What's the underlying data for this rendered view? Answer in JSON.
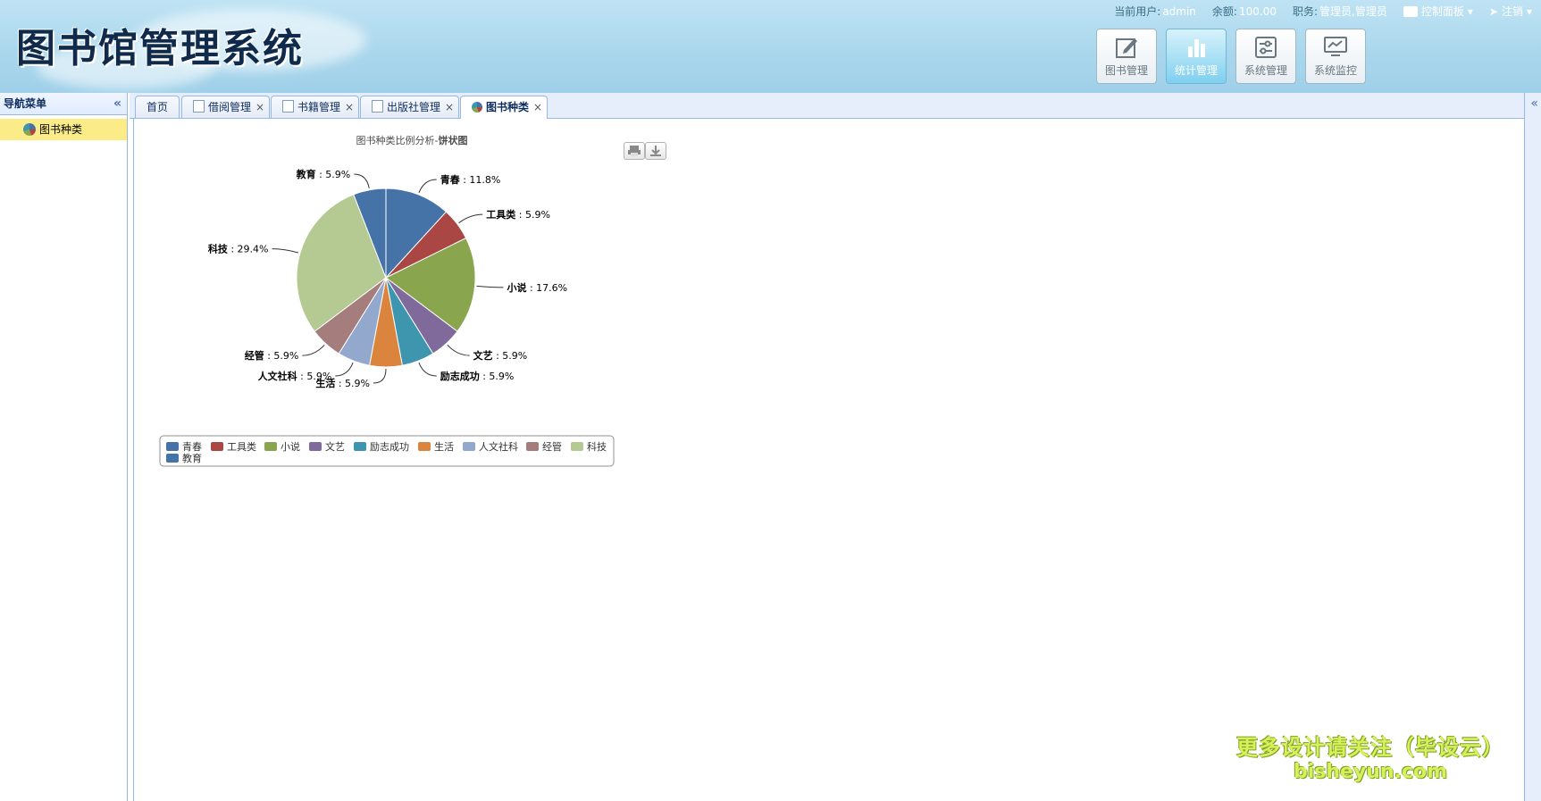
{
  "header": {
    "title": "图书馆管理系统",
    "current_user_label": "当前用户:",
    "current_user": "admin",
    "balance_label": "余额:",
    "balance": "100.00",
    "role_label": "职务:",
    "role": "管理员,管理员",
    "control_panel": "控制面板",
    "logout": "注销",
    "modules": [
      {
        "label": "图书管理",
        "icon": "edit-icon",
        "active": false
      },
      {
        "label": "统计管理",
        "icon": "bar-chart-icon",
        "active": true
      },
      {
        "label": "系统管理",
        "icon": "settings-sliders-icon",
        "active": false
      },
      {
        "label": "系统监控",
        "icon": "monitor-icon",
        "active": false
      }
    ]
  },
  "sidebar": {
    "title": "导航菜单",
    "items": [
      {
        "label": "图书种类",
        "selected": true
      }
    ]
  },
  "tabs": [
    {
      "label": "首页",
      "closable": false,
      "active": false
    },
    {
      "label": "借阅管理",
      "closable": true,
      "active": false
    },
    {
      "label": "书籍管理",
      "closable": true,
      "active": false
    },
    {
      "label": "出版社管理",
      "closable": true,
      "active": false
    },
    {
      "label": "图书种类",
      "closable": true,
      "active": true
    }
  ],
  "chart_data": {
    "type": "pie",
    "title": "图书种类比例分析- 饼状图",
    "title_main": "图书种类比例分析-",
    "title_bold": "饼状图",
    "slices": [
      {
        "name": "青春",
        "value": 11.8,
        "color": "#4572A7"
      },
      {
        "name": "工具类",
        "value": 5.9,
        "color": "#AA4643"
      },
      {
        "name": "小说",
        "value": 17.6,
        "color": "#89A54E"
      },
      {
        "name": "文艺",
        "value": 5.9,
        "color": "#80699B"
      },
      {
        "name": "励志成功",
        "value": 5.9,
        "color": "#3D96AE"
      },
      {
        "name": "生活",
        "value": 5.9,
        "color": "#DB843D"
      },
      {
        "name": "人文社科",
        "value": 5.9,
        "color": "#92A8CD"
      },
      {
        "name": "经管",
        "value": 5.9,
        "color": "#A47D7C"
      },
      {
        "name": "科技",
        "value": 29.4,
        "color": "#B5CA92"
      },
      {
        "name": "教育",
        "value": 5.9,
        "color": "#4572A7"
      }
    ],
    "legend_position": "bottom"
  },
  "watermark": {
    "line1": "更多设计请关注（毕设云）",
    "line2": "bisheyun.com"
  }
}
